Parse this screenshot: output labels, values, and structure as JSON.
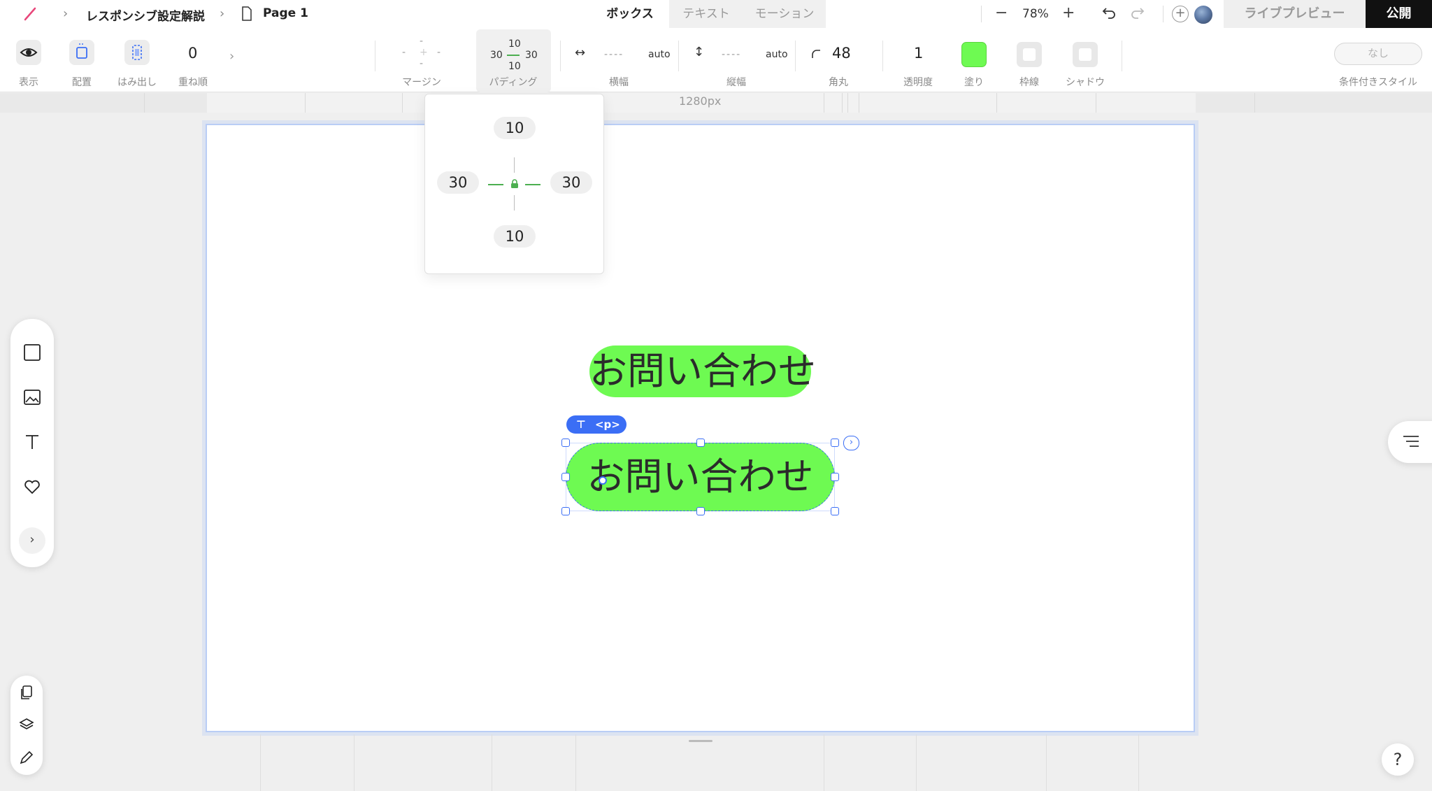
{
  "header": {
    "project_title": "レスポンシブ設定解説",
    "page_name": "Page 1",
    "tabs": [
      {
        "label": "ボックス",
        "active": true
      },
      {
        "label": "テキスト",
        "active": false
      },
      {
        "label": "モーション",
        "active": false
      }
    ],
    "zoom": "78%",
    "live_preview": "ライブプレビュー",
    "publish": "公開"
  },
  "toolbar": {
    "display_label": "表示",
    "placement_label": "配置",
    "overflow_label": "はみ出し",
    "z_order_value": "0",
    "z_order_label": "重ね順",
    "margin": {
      "label": "マージン",
      "top": "-",
      "left": "-",
      "right": "-",
      "bottom": "-"
    },
    "padding": {
      "label": "パディング",
      "top": "10",
      "left": "30",
      "right": "30",
      "bottom": "10"
    },
    "width": {
      "label": "横幅",
      "value": "----",
      "unit": "auto"
    },
    "height": {
      "label": "縦幅",
      "value": "----",
      "unit": "auto"
    },
    "radius": {
      "label": "角丸",
      "value": "48"
    },
    "opacity": {
      "label": "透明度",
      "value": "1"
    },
    "fill": {
      "label": "塗り",
      "color": "#6efa52"
    },
    "border_label": "枠線",
    "shadow_label": "シャドウ",
    "conditional": {
      "button": "なし",
      "label": "条件付きスタイル"
    }
  },
  "canvas": {
    "ruler_label": "1280px",
    "button_text_1": "お問い合わせ",
    "button_text_2": "お問い合わせ",
    "selection_tag": "<p>"
  },
  "padding_popover": {
    "top": "10",
    "left": "30",
    "right": "30",
    "bottom": "10"
  },
  "colors": {
    "accent": "#3b6ef5",
    "fill_green": "#6efa52",
    "publish_bg": "#111111"
  },
  "help": "?"
}
